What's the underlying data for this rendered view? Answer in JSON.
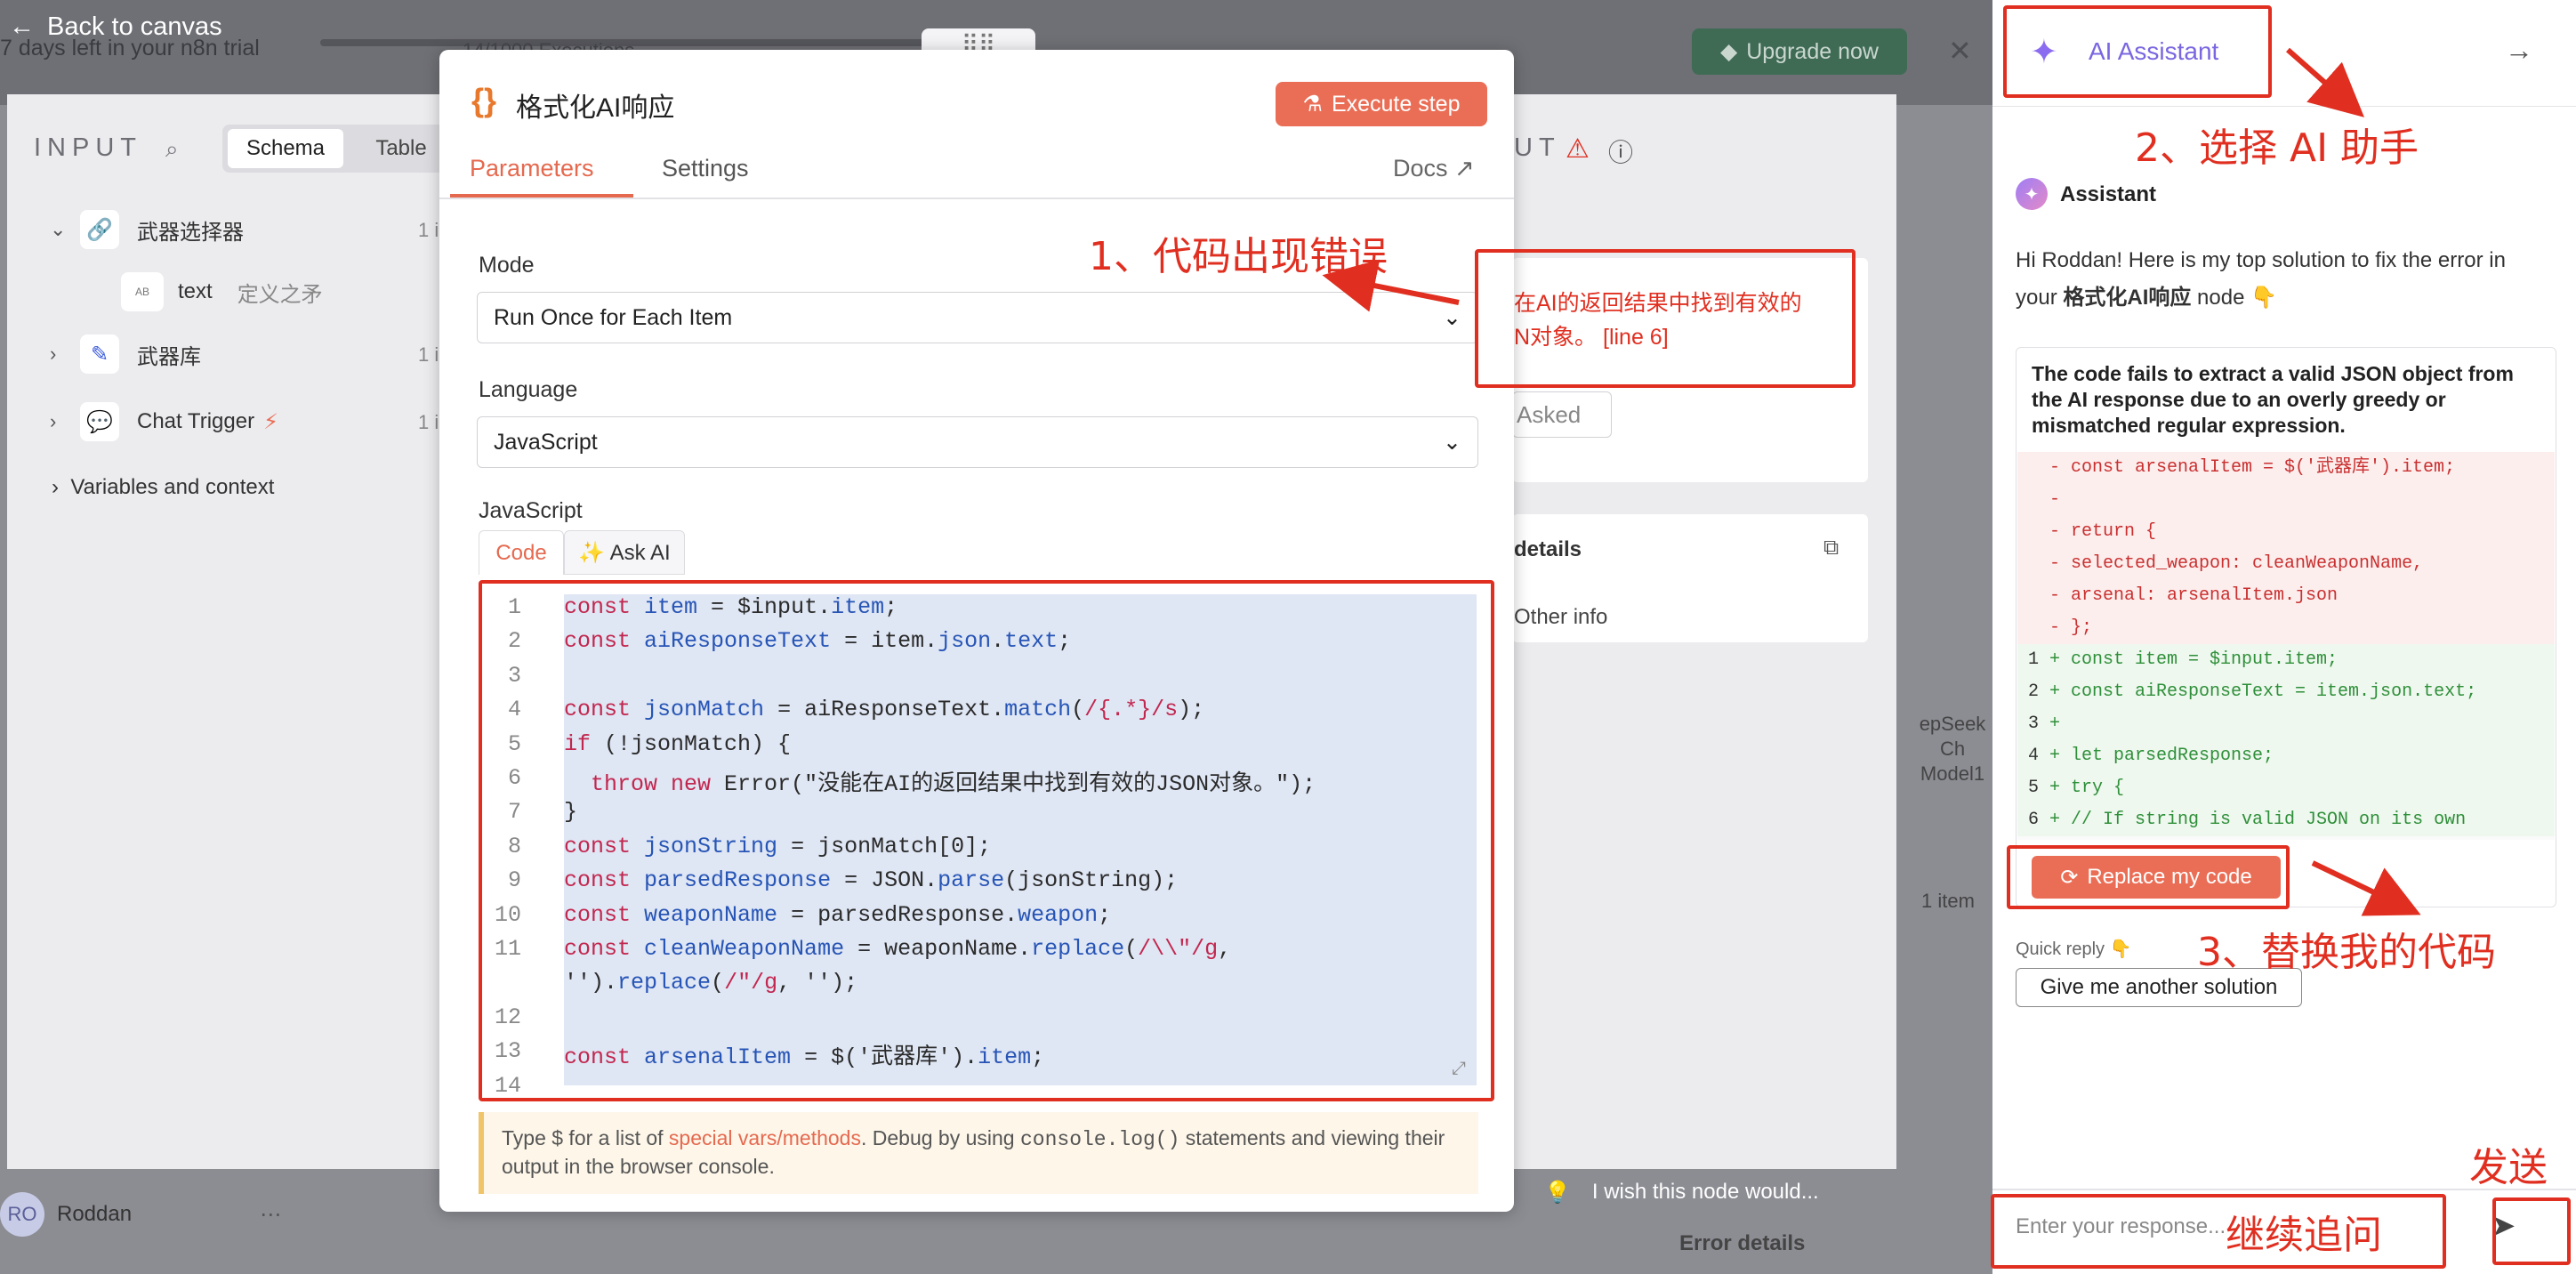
{
  "canvas": {
    "back_label": "Back to canvas",
    "trial_text": "7 days left in your n8n trial",
    "executions_text": "14/1000 Executions",
    "upgrade_label": "Upgrade now"
  },
  "input_panel": {
    "heading": "INPUT",
    "view_tabs": [
      "Schema",
      "Table"
    ],
    "tree": [
      {
        "label": "武器选择器",
        "count": "1 i"
      },
      {
        "field_type": "AB",
        "field": "text",
        "value": "定义之矛"
      },
      {
        "label": "武器库",
        "count": "1 i"
      },
      {
        "label": "Chat Trigger",
        "count": "1 i"
      }
    ],
    "variables_label": "Variables and context",
    "user_initials": "RO",
    "user_name": "Roddan"
  },
  "output_panel": {
    "heading_partial": "UT",
    "error_text_partial": "在AI的返回结果中找到有效的\nN对象。 [line 6]",
    "asked_partial": "Asked",
    "details_label": "details",
    "other_info_label": "Other info",
    "items_label": "1 item",
    "node_label_partial": "epSeek Ch",
    "node_sub_label": "Model1",
    "error_details_label": "Error details",
    "wish_label": "I wish this node would..."
  },
  "modal": {
    "drag_handle": "⠿⠿",
    "title": "格式化AI响应",
    "execute_label": "Execute step",
    "tabs": {
      "parameters": "Parameters",
      "settings": "Settings",
      "docs": "Docs"
    },
    "mode_label": "Mode",
    "mode_value": "Run Once for Each Item",
    "language_label": "Language",
    "language_value": "JavaScript",
    "code_label": "JavaScript",
    "code_tab": "Code",
    "ask_ai_tab": "✨ Ask AI",
    "code_lines": [
      {
        "n": "1",
        "html": "<span class=\"kw\">const</span> <span class=\"fn\">item</span> = $input.<span class=\"fn\">item</span>;"
      },
      {
        "n": "2",
        "html": "<span class=\"kw\">const</span> <span class=\"fn\">aiResponseText</span> = item.<span class=\"fn\">json</span>.<span class=\"fn\">text</span>;"
      },
      {
        "n": "3",
        "html": ""
      },
      {
        "n": "4",
        "html": "<span class=\"kw\">const</span> <span class=\"fn\">jsonMatch</span> = aiResponseText.<span class=\"fn\">match</span>(<span class=\"kw\">/{.*}/s</span>);"
      },
      {
        "n": "5",
        "html": "<span class=\"kw\">if</span> (!jsonMatch) {"
      },
      {
        "n": "6",
        "html": "  <span class=\"kw\">throw new</span> Error(\"没能在AI的返回结果中找到有效的JSON对象。\");"
      },
      {
        "n": "7",
        "html": "}"
      },
      {
        "n": "8",
        "html": "<span class=\"kw\">const</span> <span class=\"fn\">jsonString</span> = jsonMatch[0];"
      },
      {
        "n": "9",
        "html": "<span class=\"kw\">const</span> <span class=\"fn\">parsedResponse</span> = JSON.<span class=\"fn\">parse</span>(jsonString);"
      },
      {
        "n": "10",
        "html": "<span class=\"kw\">const</span> <span class=\"fn\">weaponName</span> = parsedResponse.<span class=\"fn\">weapon</span>;"
      },
      {
        "n": "11",
        "html": "<span class=\"kw\">const</span> <span class=\"fn\">cleanWeaponName</span> = weaponName.<span class=\"fn\">replace</span>(<span class=\"kw\">/\\\\\"/g</span>,"
      },
      {
        "n": "",
        "html": "'').<span class=\"fn\">replace</span>(<span class=\"kw\">/\"/g</span>, '');"
      },
      {
        "n": "12",
        "html": ""
      },
      {
        "n": "13",
        "html": "<span class=\"kw\">const</span> <span class=\"fn\">arsenalItem</span> = $('武器库').<span class=\"fn\">item</span>;"
      },
      {
        "n": "14",
        "html": ""
      }
    ],
    "hint_prefix": "Type $ for a list of ",
    "hint_link": "special vars/methods",
    "hint_mid": ". Debug by using ",
    "hint_code": "console.log()",
    "hint_suffix": " statements and viewing their output in the browser console."
  },
  "assistant": {
    "title": "AI Assistant",
    "sender": "Assistant",
    "greeting_prefix": "Hi Roddan! Here is my top solution to fix the error in your ",
    "greeting_node": "格式化AI响应",
    "greeting_suffix": " node 👇",
    "card_summary": "The code fails to extract a valid JSON object from the AI response due to an overly greedy or mismatched regular expression.",
    "diff": [
      {
        "n": "",
        "t": "del",
        "text": "- const arsenalItem = $('武器库').item;"
      },
      {
        "n": "",
        "t": "del",
        "text": "-"
      },
      {
        "n": "",
        "t": "del",
        "text": "- return {"
      },
      {
        "n": "",
        "t": "del",
        "text": "- selected_weapon: cleanWeaponName,"
      },
      {
        "n": "",
        "t": "del",
        "text": "- arsenal: arsenalItem.json"
      },
      {
        "n": "",
        "t": "del",
        "text": "- };"
      },
      {
        "n": "1",
        "t": "add",
        "text": "+ const item = $input.item;"
      },
      {
        "n": "2",
        "t": "add",
        "text": "+ const aiResponseText = item.json.text;"
      },
      {
        "n": "3",
        "t": "add",
        "text": "+"
      },
      {
        "n": "4",
        "t": "add",
        "text": "+ let parsedResponse;"
      },
      {
        "n": "5",
        "t": "add",
        "text": "+ try {"
      },
      {
        "n": "6",
        "t": "add",
        "text": "+ // If string is valid JSON on its own"
      }
    ],
    "replace_label": "Replace my code",
    "quick_reply_label": "Quick reply 👇",
    "quick_reply_button": "Give me another solution",
    "input_placeholder": "Enter your response..."
  },
  "annotations": {
    "step1": "1、代码出现错误",
    "step2": "2、选择 AI 助手",
    "step3": "3、替换我的代码",
    "send": "发送",
    "followup": "继续追问"
  },
  "colors": {
    "accent": "#ea6e56",
    "annotation_red": "#e02f20",
    "assistant_purple": "#7a66e0"
  }
}
